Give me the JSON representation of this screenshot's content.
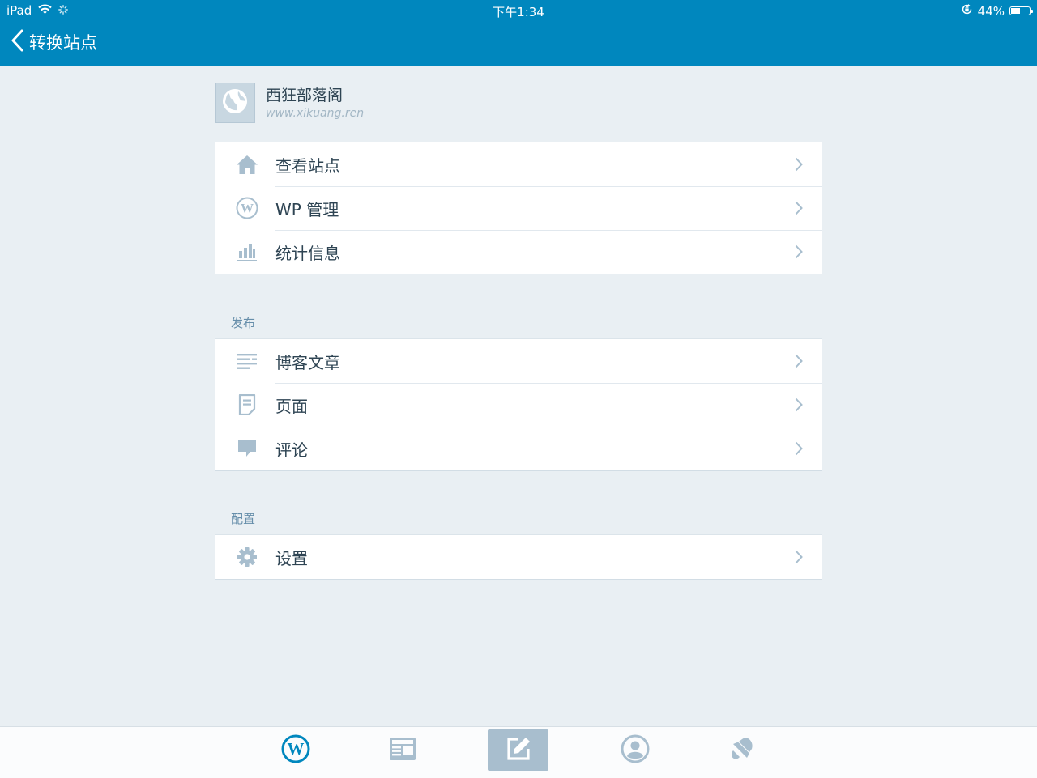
{
  "status_bar": {
    "device": "iPad",
    "time": "下午1:34",
    "battery": "44%",
    "battery_level": 0.44
  },
  "nav": {
    "back_label": "转换站点"
  },
  "site": {
    "name": "西狂部落阁",
    "url": "www.xikuang.ren"
  },
  "groups": {
    "main": [
      {
        "label": "查看站点",
        "icon": "home-icon"
      },
      {
        "label": "WP 管理",
        "icon": "wordpress-icon"
      },
      {
        "label": "统计信息",
        "icon": "stats-icon"
      }
    ],
    "publish": {
      "title": "发布",
      "items": [
        {
          "label": "博客文章",
          "icon": "posts-icon"
        },
        {
          "label": "页面",
          "icon": "page-icon"
        },
        {
          "label": "评论",
          "icon": "comment-icon"
        }
      ]
    },
    "config": {
      "title": "配置",
      "items": [
        {
          "label": "设置",
          "icon": "gear-icon"
        }
      ]
    }
  },
  "tabbar": {
    "tabs": [
      "wordpress-icon",
      "reader-icon",
      "write-icon",
      "profile-icon",
      "notifications-icon"
    ],
    "active": "write-icon"
  },
  "colors": {
    "nav_bg": "#0087be",
    "page_bg": "#e9eff3",
    "icon_gray": "#a8bece",
    "text": "#2e4453"
  }
}
